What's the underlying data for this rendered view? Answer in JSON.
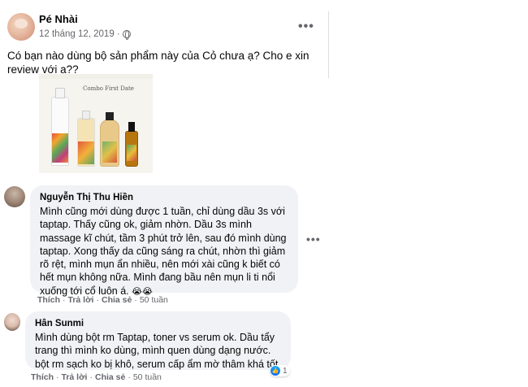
{
  "post": {
    "author": "Pé Nhài",
    "timestamp": "12 tháng 12, 2019 ·",
    "privacy_icon": "globe-icon",
    "text": "Có bạn nào dùng bộ sản phẩm này của Cỏ chưa ạ? Cho e xin review với ạ??",
    "image": {
      "banner": "Combo First Date"
    }
  },
  "comments": [
    {
      "author": "Nguyễn Thị Thu Hiền",
      "text": "Mình cũng mới dùng được 1 tuần, chỉ dùng dầu 3s với taptap. Thấy cũng ok, giảm nhờn. Dầu 3s mình massage kĩ chút, tầm 3 phút trở lên, sau đó mình dùng taptap. Xong thấy da cũng sáng ra chút, nhờn thì giảm rõ rệt, mình mụn ẩn nhiều, nên mới xài cũng k biết có hết mụn không nữa. Mình đang bầu nên mụn li ti nổi xuống tới cổ luôn á.",
      "emoji": "😭😭",
      "like": "Thích",
      "reply": "Trả lời",
      "share": "Chia sẻ",
      "time": "50 tuần"
    },
    {
      "author": "Hân Sunmi",
      "text": "Mình dùng bột rm Taptap, toner vs serum ok. Dầu tẩy trang thì mình ko dùng, mình quen dùng dạng nước. bột rm sạch ko bị khô, serum cấp ẩm mờ thâm khá tốt",
      "like": "Thích",
      "reply": "Trả lời",
      "share": "Chia sẻ",
      "time": "50 tuần",
      "reaction_count": "1"
    }
  ],
  "colors": {
    "text": "#050505",
    "secondary": "#65676b",
    "bubble": "#f0f2f5",
    "like_blue": "#0866ff"
  }
}
